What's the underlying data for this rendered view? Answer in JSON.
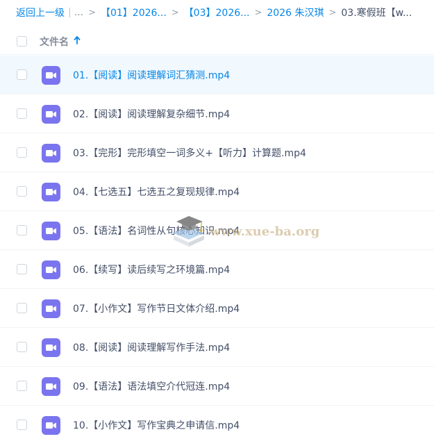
{
  "breadcrumb": {
    "back_label": "返回上一级",
    "ellipsis": "...",
    "separator": ">",
    "items": [
      {
        "label": "【01】2026..."
      },
      {
        "label": "【03】2026..."
      },
      {
        "label": "2026 朱汉琪"
      }
    ],
    "current": "03.寒假班【w..."
  },
  "header": {
    "column_title": "文件名",
    "sort_icon": "arrow-up-icon",
    "sort_direction": "ascending"
  },
  "files": [
    {
      "name": "01.【阅读】阅读理解词汇猜测.mp4",
      "icon": "video-icon",
      "hovered": true
    },
    {
      "name": "02.【阅读】阅读理解复杂细节.mp4",
      "icon": "video-icon"
    },
    {
      "name": "03.【完形】完形填空一词多义+【听力】计算题.mp4",
      "icon": "video-icon"
    },
    {
      "name": "04.【七选五】七选五之复现规律.mp4",
      "icon": "video-icon"
    },
    {
      "name": "05.【语法】名词性从句核心知识.mp4",
      "icon": "video-icon"
    },
    {
      "name": "06.【续写】读后续写之环境篇.mp4",
      "icon": "video-icon"
    },
    {
      "name": "07.【小作文】写作节日文体介绍.mp4",
      "icon": "video-icon"
    },
    {
      "name": "08.【阅读】阅读理解写作手法.mp4",
      "icon": "video-icon"
    },
    {
      "name": "09.【语法】语法填空介代冠连.mp4",
      "icon": "video-icon"
    },
    {
      "name": "10.【小作文】写作宝典之申请信.mp4",
      "icon": "video-icon"
    }
  ],
  "watermark": {
    "text": "www.xue-ba.org",
    "icon": "graduation-cap-book-icon"
  },
  "colors": {
    "link": "#0686e6",
    "text": "#424e67",
    "video_icon": "#7a75ee",
    "hover_row": "#f1f8fe"
  }
}
